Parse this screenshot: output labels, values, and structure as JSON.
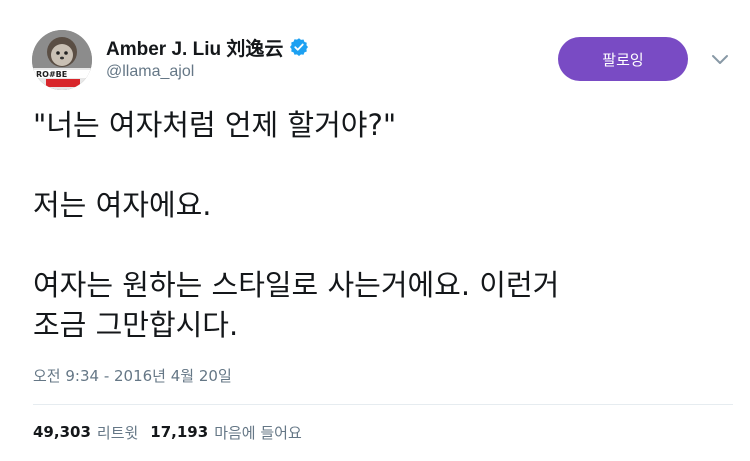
{
  "user": {
    "display_name": "Amber J. Liu 刘逸云",
    "handle": "@llama_ajol",
    "avatar_icon": "profile-photo",
    "verified_icon": "verified-badge-icon"
  },
  "follow_button": {
    "label": "팔로잉"
  },
  "tweet": {
    "line1": "\"너는 여자처럼 언제 할거야?\"",
    "line2": "저는 여자에요.",
    "line3": "여자는 원하는 스타일로 사는거에요. 이런거",
    "line4": "조금 그만합시다."
  },
  "timestamp": "오전 9:34 - 2016년 4월 20일",
  "stats": {
    "retweets_count": "49,303",
    "retweets_label": "리트윗",
    "likes_count": "17,193",
    "likes_label": "마음에 들어요"
  },
  "colors": {
    "follow_button_bg": "#794bc4",
    "verified_blue": "#1da1f2",
    "secondary_text": "#657786"
  }
}
